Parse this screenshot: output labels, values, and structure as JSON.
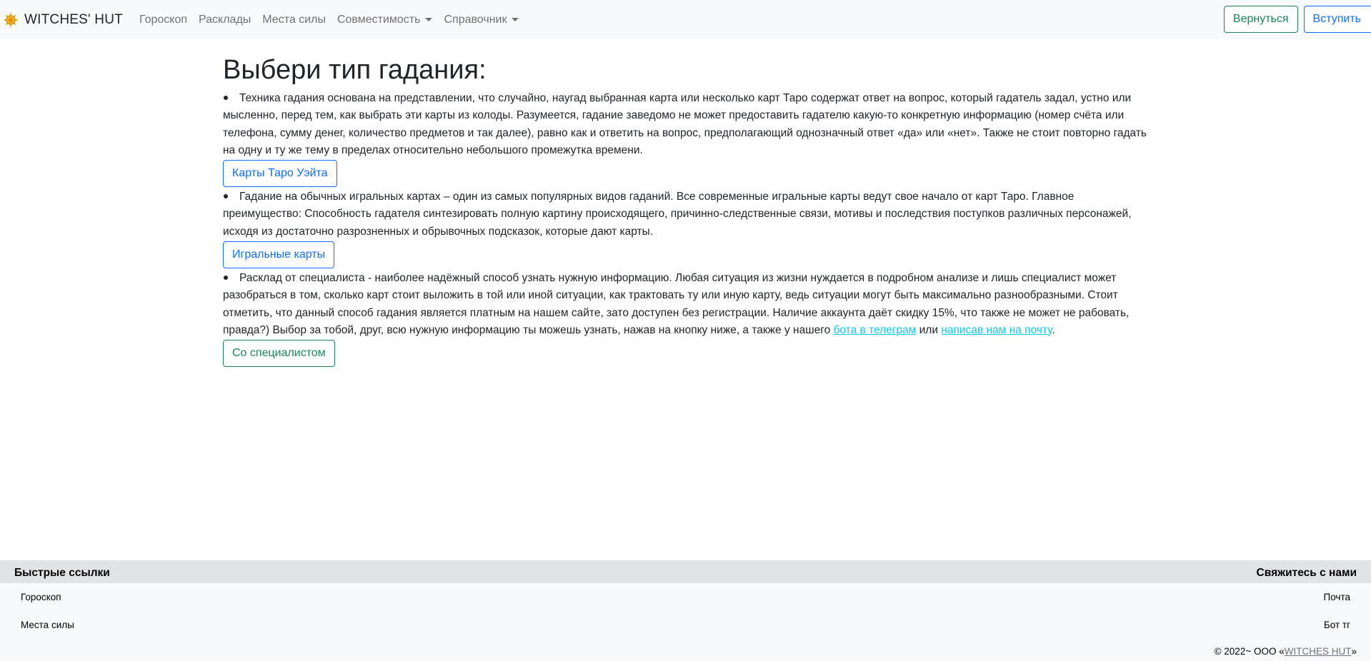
{
  "navbar": {
    "brand": "WITCHES' HUT",
    "links": [
      {
        "label": "Гороскоп"
      },
      {
        "label": "Расклады"
      },
      {
        "label": "Места силы"
      },
      {
        "label": "Совместимость"
      },
      {
        "label": "Справочник"
      }
    ],
    "return_button": "Вернуться",
    "join_button": "Вступить"
  },
  "main": {
    "title": "Выбери тип гадания:",
    "sections": [
      {
        "text": "Техника гадания основана на представлении, что случайно, наугад выбранная карта или несколько карт Таро содержат ответ на вопрос, который гадатель задал, устно или мысленно, перед тем, как выбрать эти карты из колоды. Разумеется, гадание заведомо не может предоставить гадателю какую-то конкретную информацию (номер счёта или телефона, сумму денег, количество предметов и так далее), равно как и ответить на вопрос, предполагающий однозначный ответ «да» или «нет». Также не стоит повторно гадать на одну и ту же тему в пределах относительно небольшого промежутка времени.",
        "button": "Карты Таро Уэйта"
      },
      {
        "text": "Гадание на обычных игральных картах – один из самых популярных видов гаданий. Все современные игральные карты ведут свое начало от карт Таро. Главное преимущество: Способность гадателя синтезировать полную картину происходящего, причинно-следственные связи, мотивы и последствия поступков различных персонажей, исходя из достаточно разрозненных и обрывочных подсказок, которые дают карты.",
        "button": "Игральные карты"
      },
      {
        "text": "Расклад от специалиста - наиболее надёжный способ узнать нужную информацию. Любая ситуация из жизни нуждается в подробном анализе и лишь специалист может разобраться в том, сколько карт стоит выложить в той или иной ситуации, как трактовать ту или иную карту, ведь ситуации могут быть максимально разнообразными. Стоит отметить, что данный способ гадания является платным на нашем сайте, зато доступен без регистрации. Наличие аккаунта даёт скидку 15%, что также не может не рабовать, правда?) Выбор за тобой, друг, всю нужную информацию ты можешь узнать, нажав на кнопку ниже, а также у нашего",
        "link1": "бота в телеграм",
        "middle": "или",
        "link2": "написав нам на почту",
        "end": ".",
        "button": "Со специалистом"
      }
    ]
  },
  "footer": {
    "quick_links_title": "Быстрые ссылки",
    "contact_title": "Свяжитесь с нами",
    "quick_links": [
      {
        "label": "Гороскоп"
      },
      {
        "label": "Места силы"
      }
    ],
    "contacts": [
      {
        "label": "Почта"
      },
      {
        "label": "Бот тг"
      }
    ],
    "copyright_prefix": "© 2022~ ООО «",
    "copyright_link": "WITCHES HUT",
    "copyright_suffix": "»"
  },
  "colors": {
    "navbar_bg": "#f8f9fa",
    "primary": "#0d6efd",
    "success": "#198754",
    "info_link": "#0dcaf0",
    "footer_head_bg": "#e2e3e5"
  }
}
